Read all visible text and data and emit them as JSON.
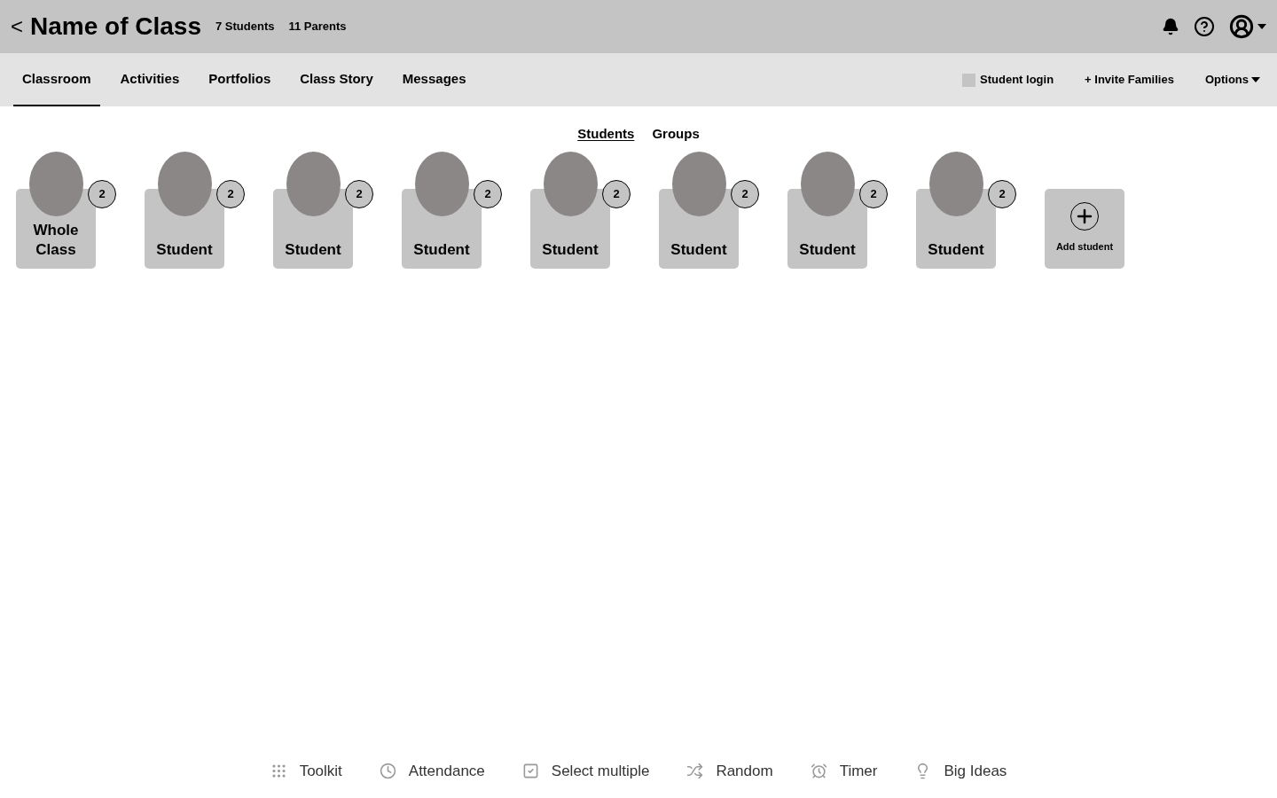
{
  "header": {
    "back": "<",
    "title": "Name of Class",
    "counts": [
      "7 Students",
      "11 Parents"
    ]
  },
  "nav": {
    "tabs": [
      {
        "label": "Classroom",
        "selected": true
      },
      {
        "label": "Activities",
        "selected": false
      },
      {
        "label": "Portfolios",
        "selected": false
      },
      {
        "label": "Class Story",
        "selected": false
      },
      {
        "label": "Messages",
        "selected": false
      }
    ],
    "student_login": {
      "label": "Student login",
      "checked": false
    },
    "invite": "+ Invite Families",
    "options": "Options"
  },
  "view_tabs": [
    {
      "label": "Students",
      "selected": true
    },
    {
      "label": "Groups",
      "selected": false
    }
  ],
  "students": [
    {
      "name": "Whole Class",
      "badge": "2"
    },
    {
      "name": "Student",
      "badge": "2"
    },
    {
      "name": "Student",
      "badge": "2"
    },
    {
      "name": "Student",
      "badge": "2"
    },
    {
      "name": "Student",
      "badge": "2"
    },
    {
      "name": "Student",
      "badge": "2"
    },
    {
      "name": "Student",
      "badge": "2"
    },
    {
      "name": "Student",
      "badge": "2"
    }
  ],
  "add_student": "Add student",
  "toolbar": [
    {
      "kind": "toolkit",
      "label": "Toolkit"
    },
    {
      "kind": "attendance",
      "label": "Attendance"
    },
    {
      "kind": "select",
      "label": "Select multiple"
    },
    {
      "kind": "random",
      "label": "Random"
    },
    {
      "kind": "timer",
      "label": "Timer"
    },
    {
      "kind": "ideas",
      "label": "Big Ideas"
    }
  ]
}
